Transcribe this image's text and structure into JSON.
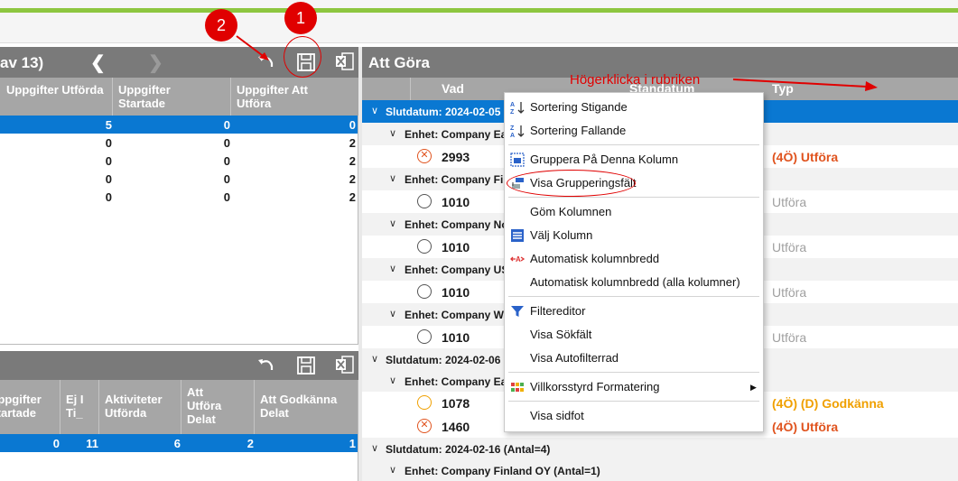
{
  "badges": [
    "2",
    "1"
  ],
  "annotation": "Högerklicka i rubriken",
  "left_top": {
    "title": "av 13)",
    "columns": [
      "Uppgifter Utförda",
      "Uppgifter Startade",
      "Uppgifter Att Utföra"
    ],
    "rows": [
      [
        "5",
        "0",
        "0"
      ],
      [
        "0",
        "0",
        "2"
      ],
      [
        "0",
        "0",
        "2"
      ],
      [
        "0",
        "0",
        "2"
      ],
      [
        "0",
        "0",
        "2"
      ]
    ]
  },
  "left_bottom": {
    "columns": [
      "Uppgifter Startade",
      "Ej I Ti_",
      "Aktiviteter Utförda",
      "Att Utföra Delat",
      "Att Godkänna Delat"
    ],
    "row": [
      "0",
      "11",
      "6",
      "2",
      "1"
    ]
  },
  "right": {
    "title": "Att Göra",
    "columns": [
      "Vad",
      "Standatum",
      "Typ"
    ],
    "groups": [
      {
        "label": "Slutdatum: 2024-02-05"
      },
      {
        "label": "Enhet: Company Eas"
      },
      {
        "label": "Enhet: Company Fin"
      },
      {
        "label": "Enhet: Company Nor"
      },
      {
        "label": "Enhet: Company US"
      },
      {
        "label": "Enhet: Company We"
      },
      {
        "label": "Slutdatum: 2024-02-06"
      },
      {
        "label": "Enhet: Company Eas"
      },
      {
        "label": "Slutdatum: 2024-02-16 (Antal=4)"
      },
      {
        "label": "Enhet: Company Finland OY (Antal=1)"
      }
    ],
    "items": [
      {
        "id": "2993",
        "type": "(4Ö) Utföra",
        "status": "overdue",
        "color": "#e0531e"
      },
      {
        "id": "1010",
        "type": "Utföra",
        "status": "open",
        "color": "#a0a0a0"
      },
      {
        "id": "1010",
        "type": "Utföra",
        "status": "open",
        "color": "#a0a0a0"
      },
      {
        "id": "1010",
        "type": "Utföra",
        "status": "open",
        "color": "#a0a0a0"
      },
      {
        "id": "1010",
        "type": "Utföra",
        "status": "open",
        "color": "#a0a0a0"
      },
      {
        "id": "1078",
        "type": "(4Ö) (D) Godkänna",
        "status": "pending",
        "color": "#f0a000"
      },
      {
        "id": "1460",
        "type": "(4Ö) Utföra",
        "status": "overdue",
        "color": "#e0531e"
      }
    ]
  },
  "menu": {
    "items": [
      {
        "label": "Sortering Stigande",
        "icon": "sort-ascending-icon"
      },
      {
        "label": "Sortering Fallande",
        "icon": "sort-descending-icon"
      },
      {
        "label": "Gruppera På Denna Kolumn",
        "icon": "group-by-column-icon"
      },
      {
        "label": "Visa Grupperingsfält",
        "icon": "group-panel-icon"
      },
      {
        "label": "Göm Kolumnen",
        "icon": ""
      },
      {
        "label": "Välj Kolumn",
        "icon": "column-chooser-icon"
      },
      {
        "label": "Automatisk kolumnbredd",
        "icon": "best-fit-icon"
      },
      {
        "label": "Automatisk kolumnbredd (alla kolumner)",
        "icon": ""
      },
      {
        "label": "Filtereditor",
        "icon": "filter-icon"
      },
      {
        "label": "Visa Sökfält",
        "icon": ""
      },
      {
        "label": "Visa Autofilterrad",
        "icon": ""
      },
      {
        "label": "Villkorsstyrd Formatering",
        "icon": "conditional-format-icon"
      },
      {
        "label": "Visa sidfot",
        "icon": ""
      }
    ]
  },
  "colors": {
    "accent_green": "#8dc63f",
    "selection_blue": "#0a78d2",
    "annotation_red": "#e00000"
  }
}
